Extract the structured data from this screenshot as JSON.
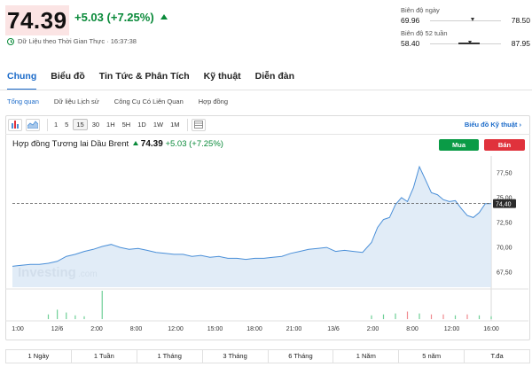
{
  "quote": {
    "price": "74.39",
    "change": "+5.03",
    "change_pct": "(+7.25%)",
    "realtime_label": "Dữ Liệu theo Thời Gian Thực · 16:37:38"
  },
  "ranges": {
    "day": {
      "label": "Biên độ ngày",
      "low": "69.96",
      "high": "78.50",
      "marker_fraction": 0.57
    },
    "week52": {
      "label": "Biên độ 52 tuần",
      "low": "58.40",
      "high": "87.95",
      "marker_fraction": 0.54
    }
  },
  "tabs": [
    "Chung",
    "Biểu đồ",
    "Tin Tức & Phân Tích",
    "Kỹ thuật",
    "Diễn đàn"
  ],
  "subtabs": [
    "Tổng quan",
    "Dữ liệu Lịch sử",
    "Công Cụ Có Liên Quan",
    "Hợp đồng"
  ],
  "toolbar": {
    "intervals": [
      "1",
      "5",
      "15",
      "30",
      "1H",
      "5H",
      "1D",
      "1W",
      "1M"
    ],
    "active_interval": "15",
    "advanced_link": "Biểu đồ Kỹ thuật",
    "advanced_chevron": "›"
  },
  "chart_header": {
    "name": "Hợp đồng Tương lai Dầu Brent",
    "price": "74.39",
    "change": "+5.03",
    "change_pct": "(+7.25%)",
    "buy_label": "Mua",
    "sell_label": "Bán"
  },
  "watermark": {
    "brand": "Investing",
    "suffix": ".com"
  },
  "colors": {
    "up": "#0a8a3a",
    "down": "#e0323c",
    "accent": "#1a6ac9",
    "area_fill": "#dce9f6",
    "area_line": "#4a8fd8"
  },
  "chart_data": {
    "type": "area",
    "ylim": [
      66,
      79
    ],
    "yticks": [
      67.5,
      70.0,
      72.5,
      75.0,
      77.5
    ],
    "ytick_labels": [
      "67,50",
      "70,00",
      "72,50",
      "75,00",
      "77,50"
    ],
    "last_price": 74.4,
    "last_price_label": "74,40",
    "xticks": [
      "1:00",
      "12/6",
      "2:00",
      "8:00",
      "12:00",
      "15:00",
      "18:00",
      "21:00",
      "13/6",
      "2:00",
      "8:00",
      "12:00",
      "16:00"
    ],
    "x": [
      0,
      3,
      6,
      9,
      12,
      15,
      18,
      21,
      24,
      27,
      30,
      33,
      36,
      39,
      42,
      45,
      48,
      51,
      54,
      57,
      60,
      63,
      66,
      69,
      72,
      75,
      78,
      81,
      84,
      87,
      90,
      93,
      96,
      99,
      102,
      105,
      108,
      111,
      114,
      117,
      120,
      122,
      124,
      126,
      128,
      130,
      132,
      134,
      136,
      138,
      140,
      142,
      144,
      146,
      148,
      150,
      152,
      154,
      156,
      158,
      160
    ],
    "values": [
      68.1,
      68.2,
      68.3,
      68.3,
      68.4,
      68.6,
      69.1,
      69.3,
      69.6,
      69.8,
      70.1,
      70.3,
      70.0,
      69.8,
      69.9,
      69.7,
      69.5,
      69.4,
      69.3,
      69.3,
      69.1,
      69.2,
      69.0,
      69.1,
      68.9,
      68.9,
      68.8,
      68.9,
      68.9,
      69.0,
      69.1,
      69.4,
      69.6,
      69.8,
      69.9,
      70.0,
      69.6,
      69.7,
      69.6,
      69.5,
      70.5,
      72.0,
      72.8,
      73.0,
      74.3,
      75.0,
      74.6,
      76.0,
      78.1,
      76.8,
      75.5,
      75.3,
      74.8,
      74.6,
      74.7,
      73.9,
      73.2,
      73.0,
      73.5,
      74.4,
      74.4
    ],
    "volume": [
      0,
      0,
      0,
      0,
      0.5,
      1,
      0.7,
      0.4,
      0.3,
      0,
      3,
      0,
      0,
      0,
      0,
      0,
      0,
      0,
      0,
      0,
      0,
      0,
      0,
      0,
      0,
      0,
      0,
      0,
      0,
      0,
      0,
      0,
      0,
      0,
      0,
      0,
      0,
      0,
      0,
      0,
      0.4,
      0,
      0.5,
      0,
      0.6,
      0,
      0.8,
      0,
      0.6,
      0,
      0.5,
      0,
      0.5,
      0,
      0.4,
      0,
      0.5,
      0,
      0.4,
      0,
      0.3
    ]
  },
  "periods": [
    "1 Ngày",
    "1 Tuần",
    "1 Tháng",
    "3 Tháng",
    "6 Tháng",
    "1 Năm",
    "5 năm",
    "T.đa"
  ]
}
